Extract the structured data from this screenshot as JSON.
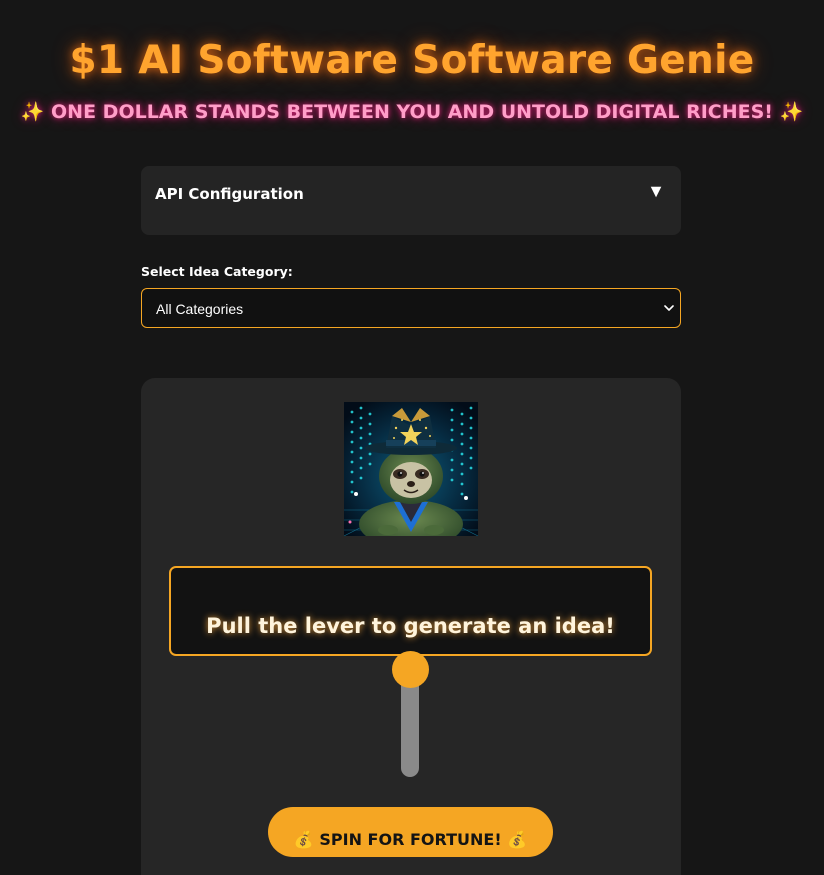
{
  "header": {
    "title": "$1 AI Software Software Genie",
    "subtitle": "✨ ONE DOLLAR STANDS BETWEEN YOU AND UNTOLD DIGITAL RICHES! ✨"
  },
  "api_config": {
    "title": "API Configuration",
    "toggle_icon": "▼",
    "expanded": false
  },
  "category": {
    "label": "Select Idea Category:",
    "selected": "All Categories"
  },
  "machine": {
    "avatar_icon": "genie-sloth-avatar",
    "display_text": "Pull the lever to generate an idea!",
    "lever_position": 0,
    "spin_button_label": "💰 SPIN FOR FORTUNE! 💰"
  },
  "colors": {
    "accent": "#f5a623",
    "title_glow": "#ffa42e",
    "subtitle": "#ff9ec8",
    "background": "#161616",
    "panel": "#262626"
  }
}
